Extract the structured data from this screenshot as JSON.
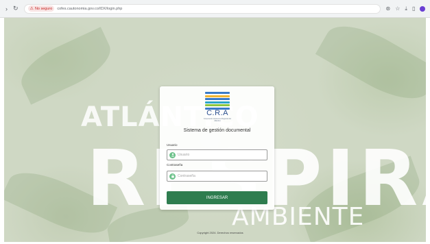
{
  "browser": {
    "security_label": "No seguro",
    "url": "cofes.cautonomia.gov.co/IDX/login.php"
  },
  "background": {
    "line1": "ATLÁNTICO",
    "line2": "RESPIRA",
    "line3": "AMBIENTE"
  },
  "logo": {
    "name": "C.R.A",
    "subtitle": "Corporación Autónoma Regional del Atlántico",
    "colors": [
      "#3a7bc8",
      "#f2b632",
      "#3a7bc8",
      "#2aa5c9",
      "#8cc63f",
      "#3a7bc8"
    ]
  },
  "login": {
    "title": "Sistema de gestión documental",
    "user_label": "Usuario",
    "user_placeholder": "Usuario",
    "pass_label": "Contraseña",
    "pass_placeholder": "Contraseña",
    "submit_label": "INGRESAR"
  },
  "footer": {
    "text": "Copyright 2024. Derechos reservados"
  },
  "colors": {
    "primary": "#2e7d4f",
    "field_icon": "#6cc18a"
  }
}
